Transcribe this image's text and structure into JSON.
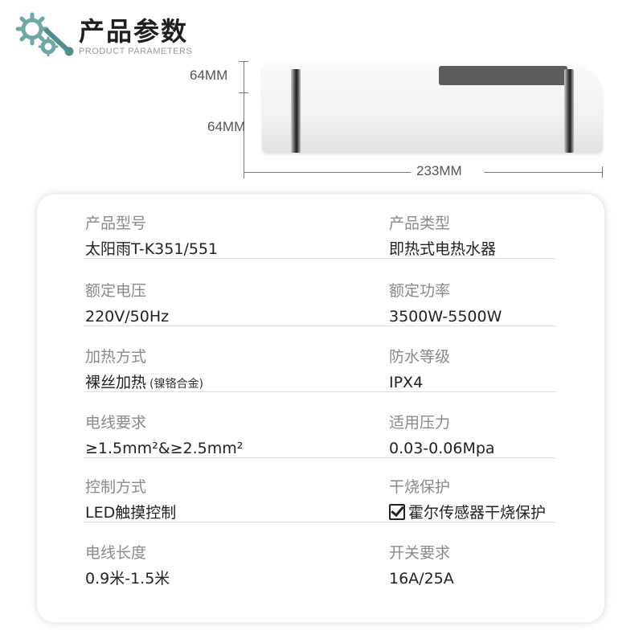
{
  "header": {
    "title": "产品参数",
    "subtitle": "PRODUCT PARAMETERS",
    "icon": "gears-wrench-icon",
    "accent_color": "#6fa7a5"
  },
  "dimensions": {
    "height_top": "64MM",
    "height_side": "64MM",
    "width": "233MM"
  },
  "params": [
    {
      "label": "产品型号",
      "value": "太阳雨T-K351/551"
    },
    {
      "label": "产品类型",
      "value": "即热式电热水器"
    },
    {
      "label": "额定电压",
      "value": "220V/50Hz"
    },
    {
      "label": "额定功率",
      "value": "3500W-5500W"
    },
    {
      "label": "加热方式",
      "value": "裸丝加热",
      "note": "(镍铬合金)"
    },
    {
      "label": "防水等级",
      "value": "IPX4"
    },
    {
      "label": "电线要求",
      "value": "≥1.5mm²&≥2.5mm²"
    },
    {
      "label": "适用压力",
      "value": "0.03-0.06Mpa"
    },
    {
      "label": "控制方式",
      "value": "LED触摸控制"
    },
    {
      "label": "干烧保护",
      "value": "霍尔传感器干烧保护",
      "icon": "checkbox-checked-icon"
    },
    {
      "label": "电线长度",
      "value": "0.9米-1.5米"
    },
    {
      "label": "开关要求",
      "value": "16A/25A"
    }
  ]
}
